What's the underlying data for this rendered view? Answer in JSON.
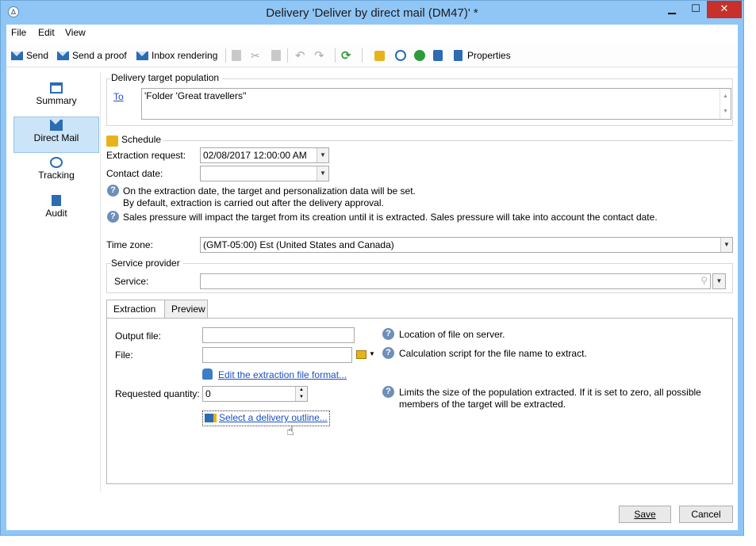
{
  "window": {
    "title": "Delivery 'Deliver by direct mail (DM47)' *",
    "minimize": "▁",
    "maximize": "☐",
    "close": "✕"
  },
  "menu": [
    "File",
    "Edit",
    "View"
  ],
  "toolbar": {
    "send": "Send",
    "send_proof": "Send a proof",
    "inbox_rendering": "Inbox rendering",
    "properties": "Properties"
  },
  "sidebar": {
    "items": [
      {
        "label": "Summary",
        "icon": "summary-icon"
      },
      {
        "label": "Direct Mail",
        "icon": "direct-mail-icon",
        "active": true
      },
      {
        "label": "Tracking",
        "icon": "tracking-icon"
      },
      {
        "label": "Audit",
        "icon": "audit-icon"
      }
    ]
  },
  "target": {
    "group_label": "Delivery target population",
    "to_link": "To",
    "to_value": "'Folder 'Great travellers''"
  },
  "schedule": {
    "group_label": "Schedule",
    "extraction_label": "Extraction request:",
    "extraction_value": "02/08/2017 12:00:00 AM",
    "contact_label": "Contact date:",
    "contact_value": "",
    "help1_line1": "On the extraction date, the target and personalization data will be set.",
    "help1_line2": "By default, extraction is carried out after the delivery approval.",
    "help2": "Sales pressure will impact the target from its creation until it is extracted. Sales pressure will take into account the contact date."
  },
  "timezone": {
    "label": "Time zone:",
    "value": "(GMT-05:00) Est (United States and Canada)"
  },
  "service_provider": {
    "group_label": "Service provider",
    "service_label": "Service:",
    "service_value": ""
  },
  "tabs": {
    "extraction": "Extraction",
    "preview": "Preview"
  },
  "extraction": {
    "output_file_label": "Output file:",
    "output_file_value": "",
    "output_file_help": "Location of file on server.",
    "file_label": "File:",
    "file_value": "",
    "file_help": "Calculation script for the file name to extract.",
    "edit_format_link": "Edit the extraction file format...",
    "requested_qty_label": "Requested quantity:",
    "requested_qty_value": "0",
    "qty_help_line1": "Limits the size of the population extracted. If it is set to zero, all possible",
    "qty_help_line2": "members of the target will be extracted.",
    "select_outline_link": "Select a delivery outline..."
  },
  "buttons": {
    "save": "Save",
    "cancel": "Cancel"
  },
  "colors": {
    "frame": "#90c6f6",
    "close": "#c7302b",
    "active_sidebar": "#cce4f7",
    "link": "#1a4fc4"
  }
}
